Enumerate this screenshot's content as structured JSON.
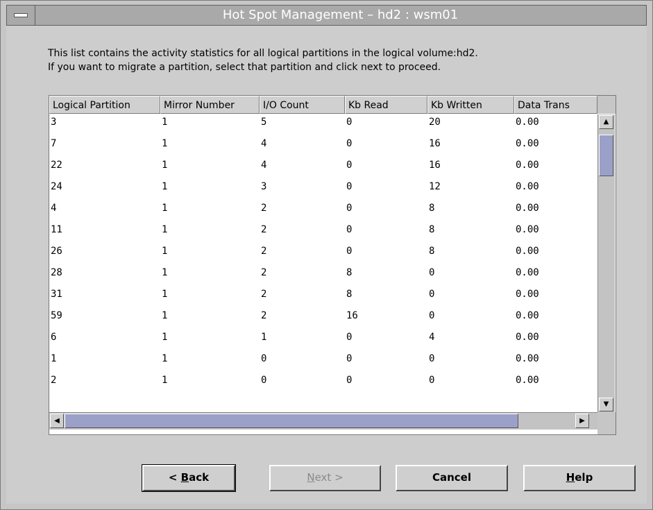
{
  "window": {
    "title": "Hot Spot Management – hd2 : wsm01"
  },
  "description": {
    "line1": "This list contains the activity statistics for all logical partitions in the logical volume:hd2.",
    "line2": "If you want to migrate a partition, select that partition and click next to proceed."
  },
  "table": {
    "headers": [
      "Logical Partition",
      "Mirror Number",
      "I/O Count",
      "Kb Read",
      "Kb Written",
      "Data Trans"
    ],
    "rows": [
      [
        "3",
        "1",
        "5",
        "0",
        "20",
        "0.00"
      ],
      [
        "7",
        "1",
        "4",
        "0",
        "16",
        "0.00"
      ],
      [
        "22",
        "1",
        "4",
        "0",
        "16",
        "0.00"
      ],
      [
        "24",
        "1",
        "3",
        "0",
        "12",
        "0.00"
      ],
      [
        "4",
        "1",
        "2",
        "0",
        "8",
        "0.00"
      ],
      [
        "11",
        "1",
        "2",
        "0",
        "8",
        "0.00"
      ],
      [
        "26",
        "1",
        "2",
        "0",
        "8",
        "0.00"
      ],
      [
        "28",
        "1",
        "2",
        "8",
        "0",
        "0.00"
      ],
      [
        "31",
        "1",
        "2",
        "8",
        "0",
        "0.00"
      ],
      [
        "59",
        "1",
        "2",
        "16",
        "0",
        "0.00"
      ],
      [
        "6",
        "1",
        "1",
        "0",
        "4",
        "0.00"
      ],
      [
        "1",
        "1",
        "0",
        "0",
        "0",
        "0.00"
      ],
      [
        "2",
        "1",
        "0",
        "0",
        "0",
        "0.00"
      ]
    ]
  },
  "buttons": {
    "back_prefix": "< ",
    "back_mnemonic": "B",
    "back_rest": "ack",
    "next_mnemonic": "N",
    "next_rest": "ext >",
    "cancel": "Cancel",
    "help_mnemonic": "H",
    "help_rest": "elp"
  },
  "icons": {
    "window_menu": "window-menu-icon",
    "scroll_up": "arrow-up-icon",
    "scroll_down": "arrow-down-icon",
    "scroll_left": "arrow-left-icon",
    "scroll_right": "arrow-right-icon"
  }
}
